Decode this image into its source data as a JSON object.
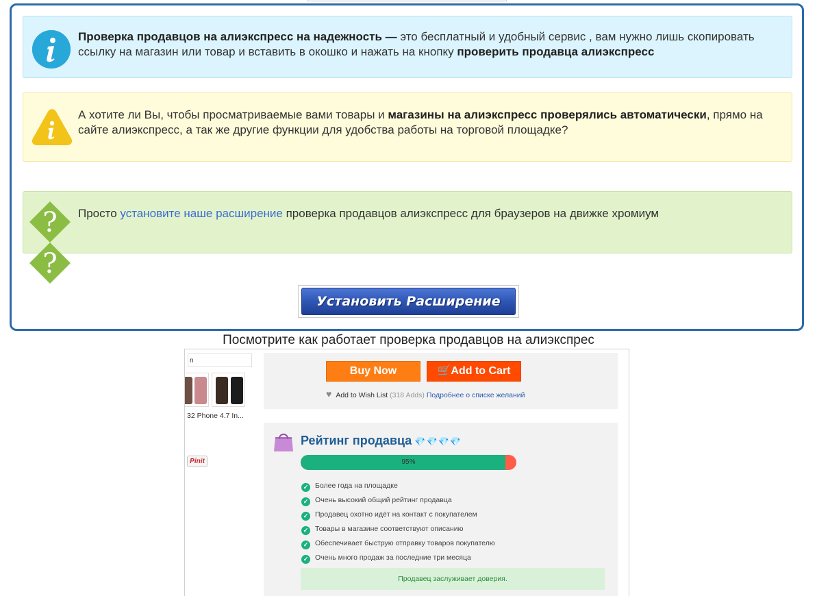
{
  "info": {
    "bold_lead": "Проверка продавцов на алиэкспресс на надежность —",
    "text": " это бесплатный и удобный сервис , вам нужно лишь скопировать ссылку на магазин или товар и вставить в окошко и нажать на кнопку ",
    "bold_tail": "проверить продавца алиэкспресс"
  },
  "warning": {
    "text_a": "А хотите ли Вы, чтобы просматриваемые вами товары и ",
    "bold": "магазины на алиэкспресс проверялись автоматически",
    "text_b": ", прямо на сайте алиэкспресс, а так же другие функции для удобства работы на торговой площадке?"
  },
  "help": {
    "text_a": "Просто ",
    "link": "установите наше расширение",
    "text_b": " проверка продавцов алиэкспресс для браузеров на движке хромиум"
  },
  "install_button": "Установить Расширение",
  "caption": "Посмотрите как работает проверка продавцов на алиэкспрес",
  "demo": {
    "strip_label": "n",
    "product_name": "32 Phone 4.7 In...",
    "pinit": "Pinit",
    "buy_now": "Buy Now",
    "add_to_cart": "Add to Cart",
    "wish_label": "Add to Wish List",
    "wish_count": "(318 Adds)",
    "wish_link": "Подробнее о списке желаний",
    "rating_title": "Рейтинг продавца",
    "gems": "💎💎💎💎",
    "rating_percent": 95,
    "rating_label": "95%",
    "checks": [
      "Более года на площадке",
      "Очень высокий общий рейтинг продавца",
      "Продавец охотно идёт на контакт с покупателем",
      "Товары в магазине соответствуют описанию",
      "Обеспечивает быструю отправку товаров покупателю",
      "Очень много продаж за последние три месяца"
    ],
    "verdict": "Продавец заслуживает доверия."
  },
  "colors": {
    "frame_border": "#2c6aa8",
    "info_bg": "#dbf4fd",
    "warn_bg": "#fefcdb",
    "help_bg": "#e2f3cc",
    "rating_green": "#1bb17e",
    "rating_red": "#ff5c4a"
  },
  "icons": [
    "info-icon",
    "warning-icon",
    "question-icon",
    "heart-icon",
    "cart-icon",
    "shopping-bag-icon",
    "check-icon",
    "diamond-icon"
  ]
}
